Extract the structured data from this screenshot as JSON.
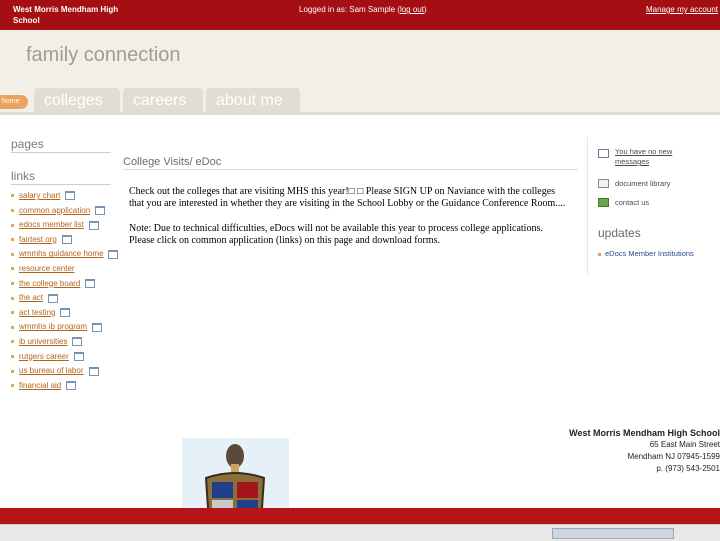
{
  "topbar": {
    "school_name": "West Morris Mendham High School",
    "logged_in_prefix": "Logged in as: Sam Sample (",
    "logout_label": "log out",
    "logged_in_suffix": ")",
    "manage_account": "Manage my account"
  },
  "header": {
    "brand": "family connection",
    "home_tab": "home",
    "tabs": [
      "colleges",
      "careers",
      "about me"
    ]
  },
  "sidebar": {
    "pages_heading": "pages",
    "links_heading": "links",
    "links": [
      "salary chart",
      "common application",
      "edocs member list",
      "fairtest.org",
      "wmmhs guidance home",
      "resource center",
      "the college board",
      "the act",
      "act testing",
      "wmmhs ib program",
      "ib universities",
      "rutgers career",
      "us bureau of labor",
      "financial aid"
    ]
  },
  "main": {
    "heading": "College Visits/ eDoc",
    "paragraph1": "Check out the colleges that are visiting MHS this year!□ □ Please SIGN UP on Naviance with the colleges that you are interested in whether they are visiting in the School Lobby or the Guidance Conference Room....",
    "paragraph2": "Note: Due to technical difficulties, eDocs will not be available this year to process college applications. Please click on common application (links) on this page and download forms."
  },
  "right": {
    "messages": "You have no new messages",
    "document_library": "document library",
    "contact_us": "contact us",
    "updates_heading": "updates",
    "update_item": "eDocs Member Institutions"
  },
  "address": {
    "name": "West Morris Mendham High School",
    "street": "65 East Main Street",
    "city": "Mendham NJ 07945-1599",
    "phone": "p. (973) 543-2501"
  }
}
